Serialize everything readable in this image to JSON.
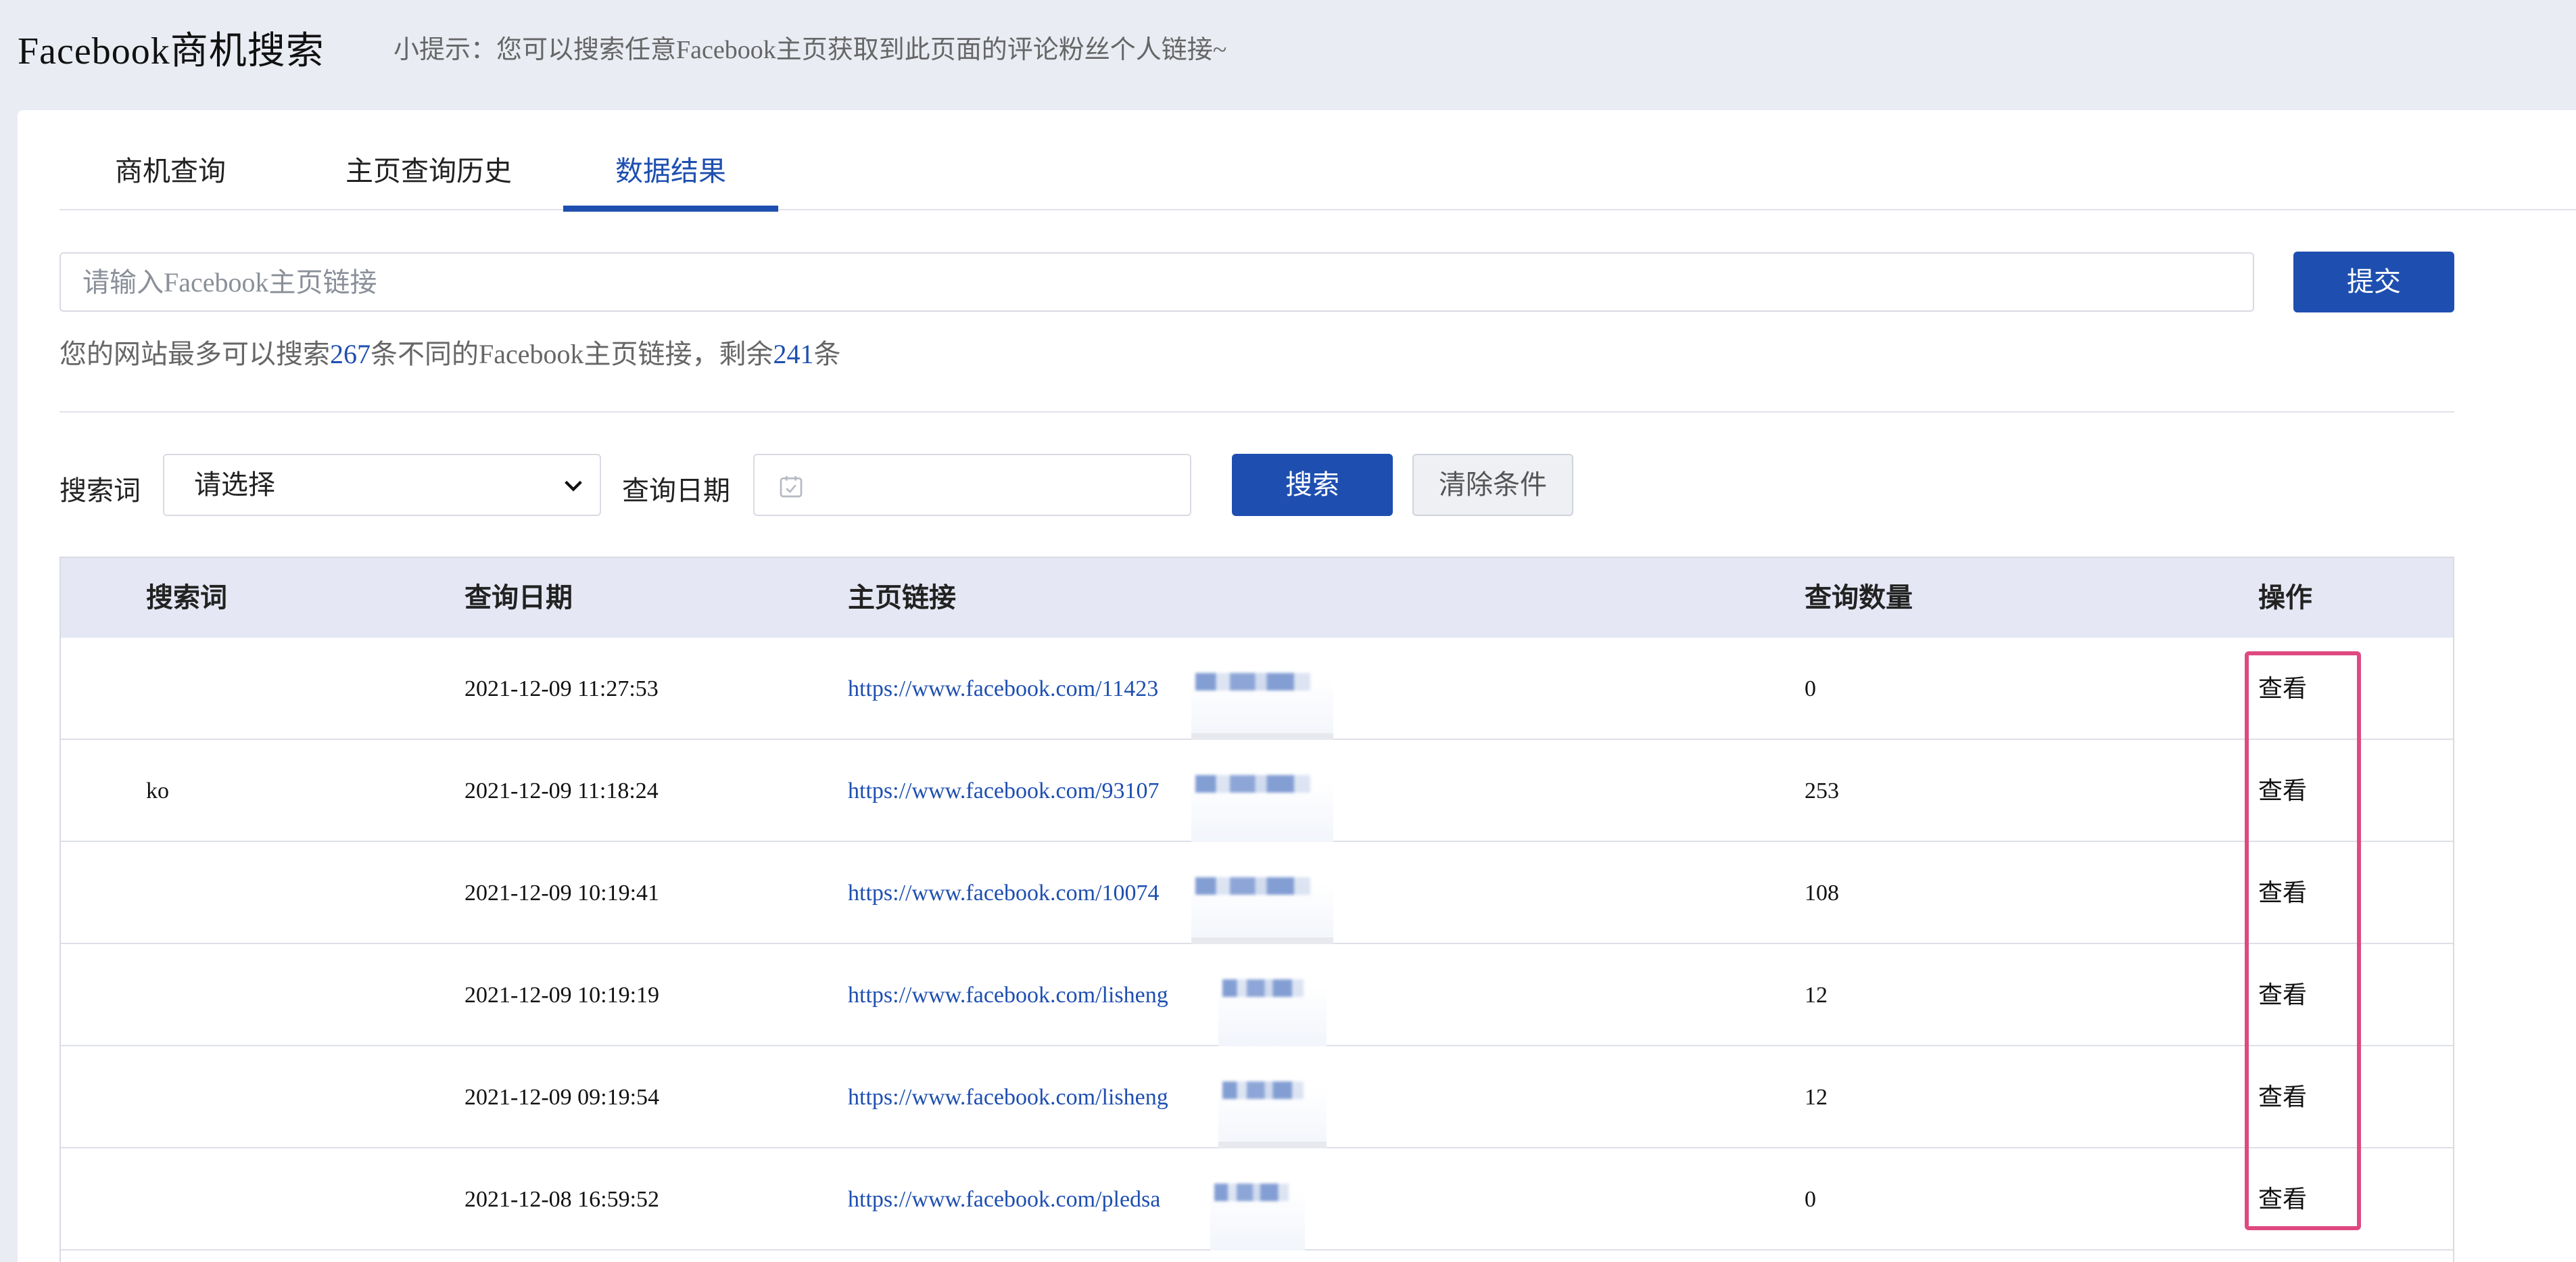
{
  "header": {
    "title": "Facebook商机搜索",
    "tip": "小提示：您可以搜索任意Facebook主页获取到此页面的评论粉丝个人链接~"
  },
  "tabs": [
    {
      "label": "商机查询",
      "active": false
    },
    {
      "label": "主页查询历史",
      "active": false
    },
    {
      "label": "数据结果",
      "active": true
    }
  ],
  "url_input": {
    "placeholder": "请输入Facebook主页链接",
    "value": ""
  },
  "submit_label": "提交",
  "quota": {
    "prefix": "您的网站最多可以搜索",
    "total": "267",
    "middle": "条不同的Facebook主页链接，剩余",
    "remaining": "241",
    "suffix": "条"
  },
  "filter": {
    "keyword_label": "搜索词",
    "keyword_selected": "请选择",
    "date_label": "查询日期",
    "date_value": "",
    "search_label": "搜索",
    "clear_label": "清除条件"
  },
  "table": {
    "headers": [
      "搜索词",
      "查询日期",
      "主页链接",
      "查询数量",
      "操作"
    ],
    "rows": [
      {
        "keyword": "",
        "date": "2021-12-09 11:27:53",
        "link": "https://www.facebook.com/11423",
        "count": "0",
        "action": "查看"
      },
      {
        "keyword": "ko",
        "date": "2021-12-09 11:18:24",
        "link": "https://www.facebook.com/93107",
        "count": "253",
        "action": "查看"
      },
      {
        "keyword": "",
        "date": "2021-12-09 10:19:41",
        "link": "https://www.facebook.com/10074",
        "count": "108",
        "action": "查看"
      },
      {
        "keyword": "",
        "date": "2021-12-09 10:19:19",
        "link": "https://www.facebook.com/lisheng",
        "count": "12",
        "action": "查看"
      },
      {
        "keyword": "",
        "date": "2021-12-09 09:19:54",
        "link": "https://www.facebook.com/lisheng",
        "count": "12",
        "action": "查看"
      },
      {
        "keyword": "",
        "date": "2021-12-08 16:59:52",
        "link": "https://www.facebook.com/pledsa",
        "count": "0",
        "action": "查看"
      }
    ]
  },
  "colors": {
    "accent": "#1e4fb0",
    "highlight": "#de4a80",
    "header_bg": "#e9ecf3",
    "table_head_bg": "#e5e8f4"
  }
}
